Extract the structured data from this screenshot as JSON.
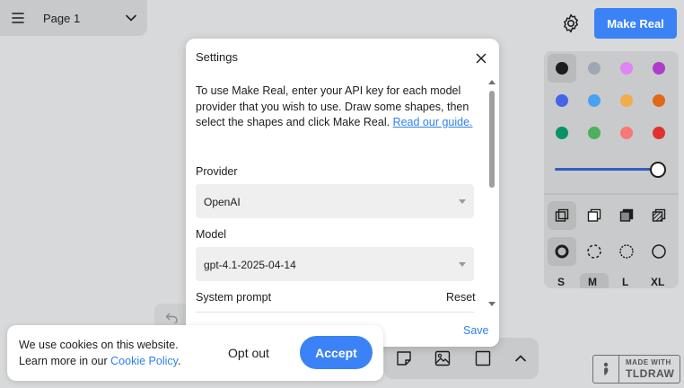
{
  "page_menu": {
    "title": "Page 1",
    "menu_icon": "hamburger-icon",
    "chevron_icon": "chevron-down-icon"
  },
  "top_right": {
    "settings_icon": "gear-icon",
    "make_real_label": "Make Real"
  },
  "style_panel": {
    "colors": [
      "#1d1d1d",
      "#9fa8b2",
      "#e085f4",
      "#ae3ec9",
      "#4465e9",
      "#4ba1f1",
      "#f1ac4b",
      "#e16919",
      "#099268",
      "#4cb05e",
      "#f87777",
      "#e03131"
    ],
    "selected_color": "#1d1d1d",
    "opacity_level": 1.0,
    "fill_styles": [
      "fill-none-icon",
      "fill-semi-icon",
      "fill-solid-icon",
      "fill-pattern-icon"
    ],
    "dash_styles": [
      "dash-draw-icon",
      "dash-dashed-icon",
      "dash-dotted-icon",
      "dash-solid-icon"
    ],
    "sizes": [
      "S",
      "M",
      "L",
      "XL"
    ],
    "selected_size": "M"
  },
  "dialog": {
    "title": "Settings",
    "intro_text": "To use Make Real, enter your API key for each model provider that you wish to use. Draw some shapes, then select the shapes and click Make Real. ",
    "guide_link": "Read our guide.",
    "provider_label": "Provider",
    "provider_value": "OpenAI",
    "model_label": "Model",
    "model_value": "gpt-4.1-2025-04-14",
    "system_prompt_label": "System prompt",
    "reset_label": "Reset",
    "save_label": "Save"
  },
  "cookie_banner": {
    "text_line1": "We use cookies on this website.",
    "text_line2_prefix": "Learn more in our ",
    "policy_link": "Cookie Policy",
    "text_line2_suffix": ".",
    "opt_out_label": "Opt out",
    "accept_label": "Accept"
  },
  "toolbar": {
    "icons": [
      "note-icon",
      "image-icon",
      "frame-icon",
      "chevron-up-icon"
    ]
  },
  "badge": {
    "line1": "MADE WITH",
    "line2": "TLDRAW"
  }
}
